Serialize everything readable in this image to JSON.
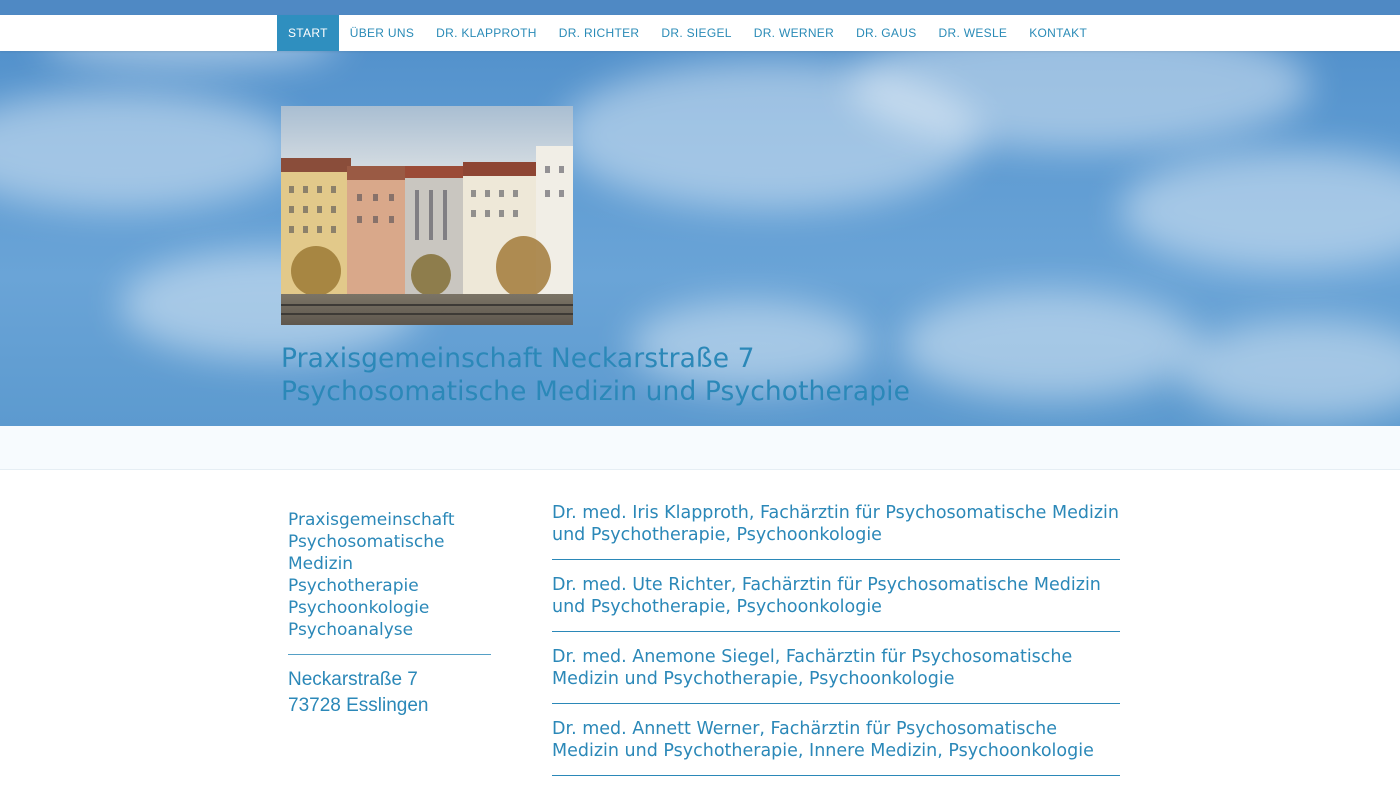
{
  "nav": {
    "items": [
      {
        "label": "START",
        "active": true
      },
      {
        "label": "ÜBER UNS",
        "active": false
      },
      {
        "label": "DR. KLAPPROTH",
        "active": false
      },
      {
        "label": "DR. RICHTER",
        "active": false
      },
      {
        "label": "DR. SIEGEL",
        "active": false
      },
      {
        "label": "DR. WERNER",
        "active": false
      },
      {
        "label": "DR. GAUS",
        "active": false
      },
      {
        "label": "DR. WESLE",
        "active": false
      },
      {
        "label": "KONTAKT",
        "active": false
      }
    ]
  },
  "hero": {
    "title_line1": "Praxisgemeinschaft Neckarstraße 7",
    "title_line2": "Psychosomatische Medizin und Psychotherapie"
  },
  "sidebar": {
    "lines": [
      "Praxisgemeinschaft",
      "Psychosomatische",
      "Medizin",
      "Psychotherapie",
      "Psychoonkologie",
      "Psychoanalyse"
    ],
    "address_street": "Neckarstraße 7",
    "address_city": "73728 Esslingen"
  },
  "doctors": [
    "Dr. med. Iris Klapproth, Fachärztin für Psychosomatische Medizin und Psychotherapie, Psychoonkologie",
    "Dr. med. Ute Richter, Fachärztin für Psychosomatische Medizin und Psychotherapie, Psychoonkologie",
    "Dr. med. Anemone Siegel, Fachärztin für Psychosomatische Medizin und Psychotherapie, Psychoonkologie",
    "Dr. med. Annett Werner, Fachärztin für Psychosomatische Medizin und Psychotherapie, Innere Medizin, Psychoonkologie"
  ],
  "colors": {
    "accent": "#2b88b8",
    "nav_active_bg": "#2f8fbf",
    "sky": "#5e9bd2"
  }
}
